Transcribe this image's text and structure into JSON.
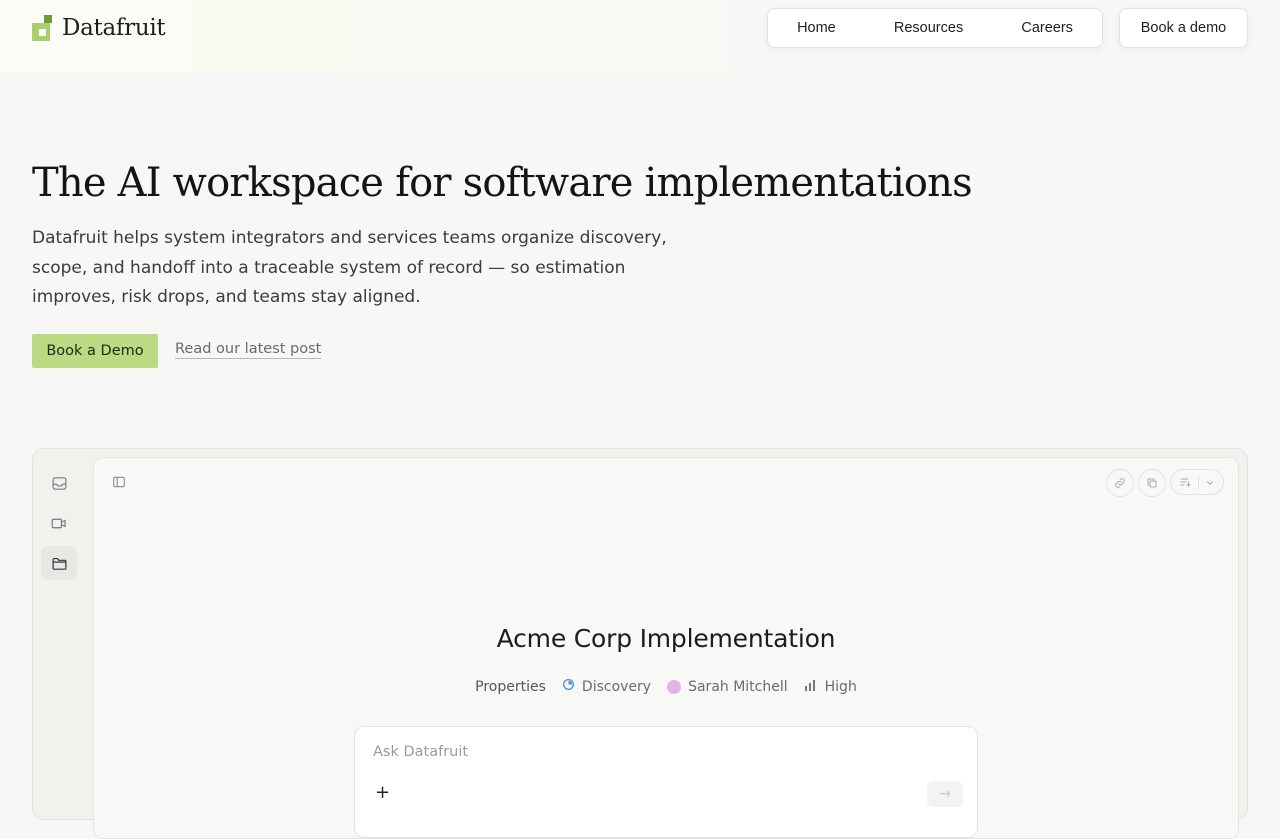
{
  "brand": {
    "name": "Datafruit"
  },
  "nav": {
    "items": [
      {
        "label": "Home"
      },
      {
        "label": "Resources"
      },
      {
        "label": "Careers"
      }
    ],
    "book_demo": "Book a demo"
  },
  "hero": {
    "title": "The AI workspace for software implementations",
    "description": "Datafruit helps system integrators and services teams organize discovery, scope, and handoff into a traceable system of record — so estimation improves, risk drops, and teams stay aligned.",
    "cta_primary": "Book a Demo",
    "cta_secondary": "Read our latest post"
  },
  "app_preview": {
    "rail_icons": [
      "inbox-icon",
      "video-icon",
      "folder-icon"
    ],
    "project_title": "Acme Corp Implementation",
    "properties": {
      "label": "Properties",
      "status": "Discovery",
      "assignee": "Sarah Mitchell",
      "priority": "High"
    },
    "ask": {
      "placeholder": "Ask Datafruit"
    }
  },
  "colors": {
    "accent": "#bcda84",
    "logo_light": "#a8cf6e",
    "logo_dark": "#6c9c3a",
    "background": "#f7f7f5"
  }
}
